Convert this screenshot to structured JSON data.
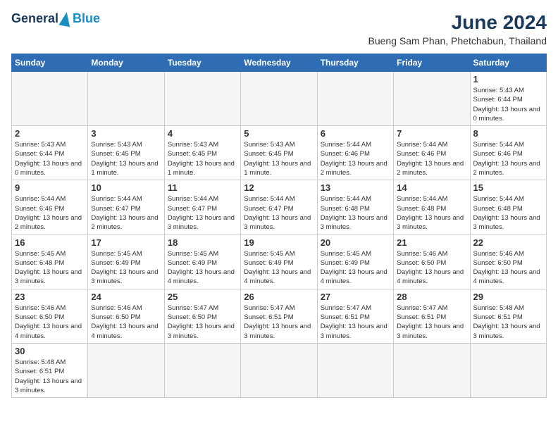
{
  "header": {
    "logo_general": "General",
    "logo_blue": "Blue",
    "month_title": "June 2024",
    "location": "Bueng Sam Phan, Phetchabun, Thailand"
  },
  "weekdays": [
    "Sunday",
    "Monday",
    "Tuesday",
    "Wednesday",
    "Thursday",
    "Friday",
    "Saturday"
  ],
  "weeks": [
    [
      {
        "day": "",
        "info": ""
      },
      {
        "day": "",
        "info": ""
      },
      {
        "day": "",
        "info": ""
      },
      {
        "day": "",
        "info": ""
      },
      {
        "day": "",
        "info": ""
      },
      {
        "day": "",
        "info": ""
      },
      {
        "day": "1",
        "info": "Sunrise: 5:43 AM\nSunset: 6:44 PM\nDaylight: 13 hours and 0 minutes."
      }
    ],
    [
      {
        "day": "2",
        "info": "Sunrise: 5:43 AM\nSunset: 6:44 PM\nDaylight: 13 hours and 0 minutes."
      },
      {
        "day": "3",
        "info": "Sunrise: 5:43 AM\nSunset: 6:45 PM\nDaylight: 13 hours and 1 minute."
      },
      {
        "day": "4",
        "info": "Sunrise: 5:43 AM\nSunset: 6:45 PM\nDaylight: 13 hours and 1 minute."
      },
      {
        "day": "5",
        "info": "Sunrise: 5:43 AM\nSunset: 6:45 PM\nDaylight: 13 hours and 1 minute."
      },
      {
        "day": "6",
        "info": "Sunrise: 5:44 AM\nSunset: 6:46 PM\nDaylight: 13 hours and 2 minutes."
      },
      {
        "day": "7",
        "info": "Sunrise: 5:44 AM\nSunset: 6:46 PM\nDaylight: 13 hours and 2 minutes."
      },
      {
        "day": "8",
        "info": "Sunrise: 5:44 AM\nSunset: 6:46 PM\nDaylight: 13 hours and 2 minutes."
      }
    ],
    [
      {
        "day": "9",
        "info": "Sunrise: 5:44 AM\nSunset: 6:46 PM\nDaylight: 13 hours and 2 minutes."
      },
      {
        "day": "10",
        "info": "Sunrise: 5:44 AM\nSunset: 6:47 PM\nDaylight: 13 hours and 2 minutes."
      },
      {
        "day": "11",
        "info": "Sunrise: 5:44 AM\nSunset: 6:47 PM\nDaylight: 13 hours and 3 minutes."
      },
      {
        "day": "12",
        "info": "Sunrise: 5:44 AM\nSunset: 6:47 PM\nDaylight: 13 hours and 3 minutes."
      },
      {
        "day": "13",
        "info": "Sunrise: 5:44 AM\nSunset: 6:48 PM\nDaylight: 13 hours and 3 minutes."
      },
      {
        "day": "14",
        "info": "Sunrise: 5:44 AM\nSunset: 6:48 PM\nDaylight: 13 hours and 3 minutes."
      },
      {
        "day": "15",
        "info": "Sunrise: 5:44 AM\nSunset: 6:48 PM\nDaylight: 13 hours and 3 minutes."
      }
    ],
    [
      {
        "day": "16",
        "info": "Sunrise: 5:45 AM\nSunset: 6:48 PM\nDaylight: 13 hours and 3 minutes."
      },
      {
        "day": "17",
        "info": "Sunrise: 5:45 AM\nSunset: 6:49 PM\nDaylight: 13 hours and 3 minutes."
      },
      {
        "day": "18",
        "info": "Sunrise: 5:45 AM\nSunset: 6:49 PM\nDaylight: 13 hours and 4 minutes."
      },
      {
        "day": "19",
        "info": "Sunrise: 5:45 AM\nSunset: 6:49 PM\nDaylight: 13 hours and 4 minutes."
      },
      {
        "day": "20",
        "info": "Sunrise: 5:45 AM\nSunset: 6:49 PM\nDaylight: 13 hours and 4 minutes."
      },
      {
        "day": "21",
        "info": "Sunrise: 5:46 AM\nSunset: 6:50 PM\nDaylight: 13 hours and 4 minutes."
      },
      {
        "day": "22",
        "info": "Sunrise: 5:46 AM\nSunset: 6:50 PM\nDaylight: 13 hours and 4 minutes."
      }
    ],
    [
      {
        "day": "23",
        "info": "Sunrise: 5:46 AM\nSunset: 6:50 PM\nDaylight: 13 hours and 4 minutes."
      },
      {
        "day": "24",
        "info": "Sunrise: 5:46 AM\nSunset: 6:50 PM\nDaylight: 13 hours and 4 minutes."
      },
      {
        "day": "25",
        "info": "Sunrise: 5:47 AM\nSunset: 6:50 PM\nDaylight: 13 hours and 3 minutes."
      },
      {
        "day": "26",
        "info": "Sunrise: 5:47 AM\nSunset: 6:51 PM\nDaylight: 13 hours and 3 minutes."
      },
      {
        "day": "27",
        "info": "Sunrise: 5:47 AM\nSunset: 6:51 PM\nDaylight: 13 hours and 3 minutes."
      },
      {
        "day": "28",
        "info": "Sunrise: 5:47 AM\nSunset: 6:51 PM\nDaylight: 13 hours and 3 minutes."
      },
      {
        "day": "29",
        "info": "Sunrise: 5:48 AM\nSunset: 6:51 PM\nDaylight: 13 hours and 3 minutes."
      }
    ],
    [
      {
        "day": "30",
        "info": "Sunrise: 5:48 AM\nSunset: 6:51 PM\nDaylight: 13 hours and 3 minutes."
      },
      {
        "day": "",
        "info": ""
      },
      {
        "day": "",
        "info": ""
      },
      {
        "day": "",
        "info": ""
      },
      {
        "day": "",
        "info": ""
      },
      {
        "day": "",
        "info": ""
      },
      {
        "day": "",
        "info": ""
      }
    ]
  ]
}
